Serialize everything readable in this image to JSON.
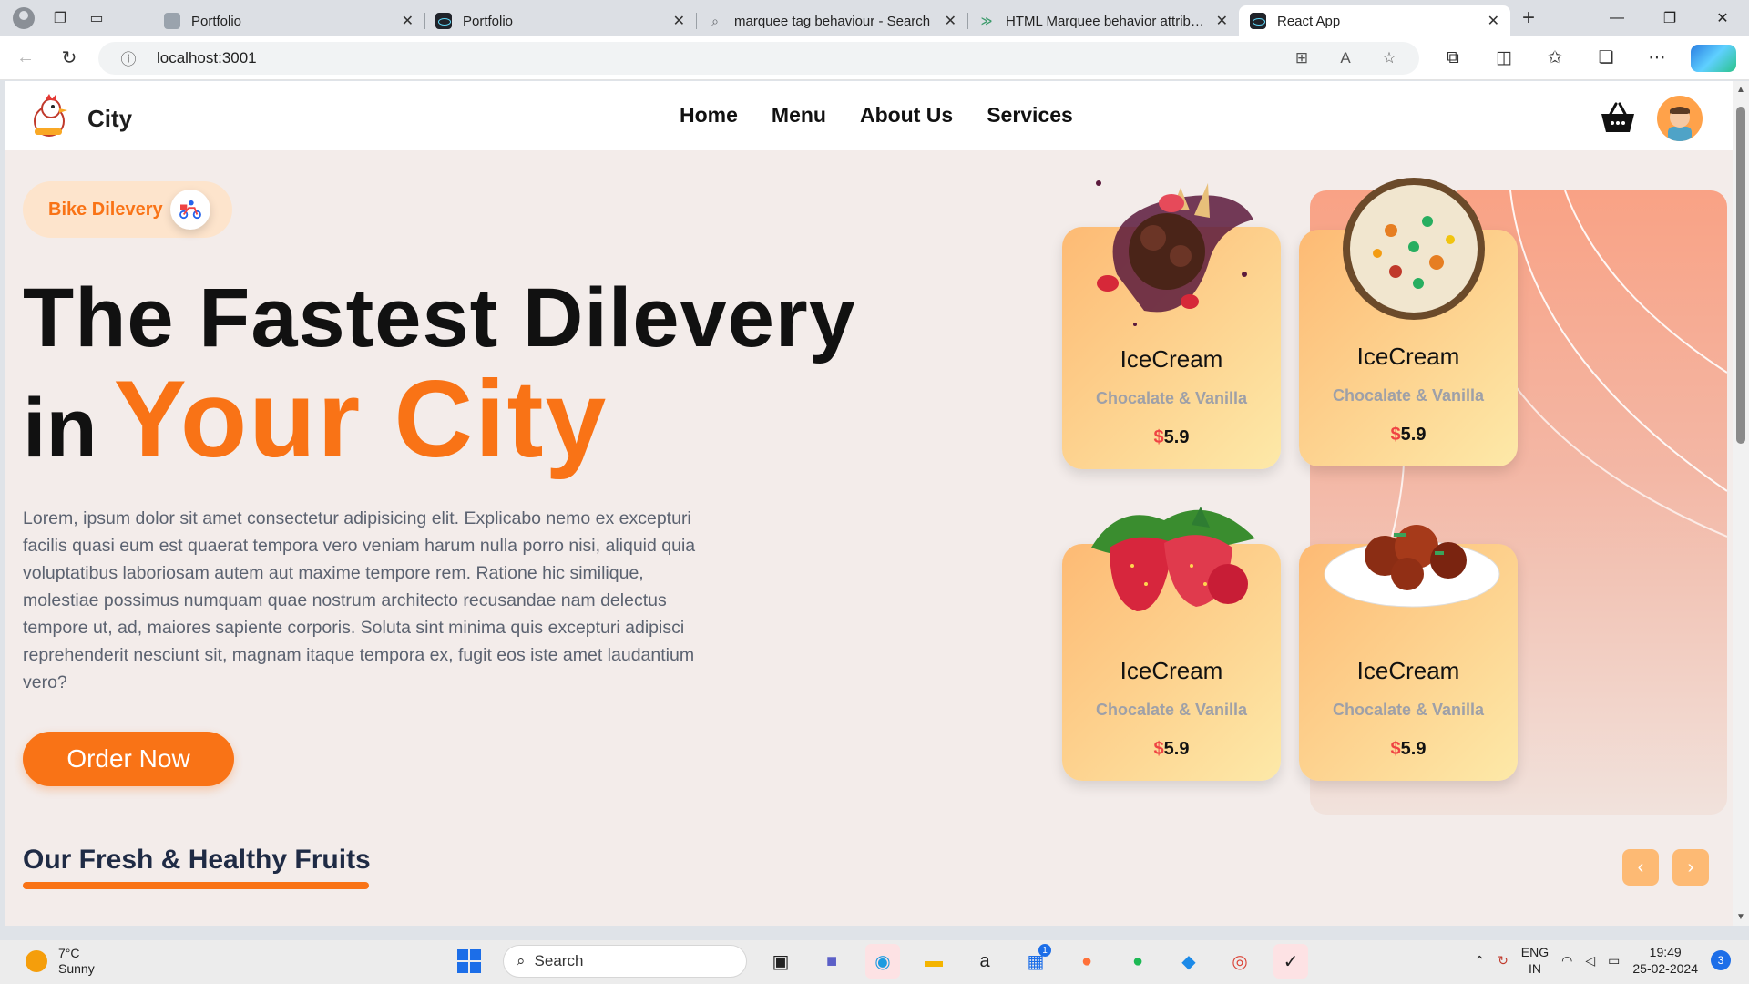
{
  "browser": {
    "tabs": [
      {
        "title": "Portfolio",
        "favicon": "generic-favicon"
      },
      {
        "title": "Portfolio",
        "favicon": "react-favicon"
      },
      {
        "title": "marquee tag behaviour - Search",
        "favicon": "search-favicon"
      },
      {
        "title": "HTML Marquee behavior attribute",
        "favicon": "code-favicon"
      },
      {
        "title": "React App",
        "favicon": "react-favicon",
        "active": true
      }
    ],
    "url": "localhost:3001"
  },
  "header": {
    "brand": "City",
    "menu": [
      "Home",
      "Menu",
      "About Us",
      "Services"
    ]
  },
  "hero": {
    "badge": "Bike Dilevery",
    "line1": "The Fastest Dilevery",
    "line2_prefix": "in",
    "line2_accent": "Your City",
    "description": "Lorem, ipsum dolor sit amet consectetur adipisicing elit. Explicabo nemo ex excepturi facilis quasi eum est quaerat tempora vero veniam harum nulla porro nisi, aliquid quia voluptatibus laboriosam autem aut maxime tempore rem. Ratione hic similique, molestiae possimus numquam quae nostrum architecto recusandae nam delectus tempore ut, ad, maiores sapiente corporis. Soluta sint minima quis excepturi adipisci reprehenderit nesciunt sit, magnam itaque tempora ex, fugit eos iste amet laudantium vero?",
    "order_button": "Order Now"
  },
  "cards": [
    {
      "title": "IceCream",
      "subtitle": "Chocalate & Vanilla",
      "currency": "$",
      "price": "5.9",
      "image": "icecream-image"
    },
    {
      "title": "IceCream",
      "subtitle": "Chocalate & Vanilla",
      "currency": "$",
      "price": "5.9",
      "image": "biryani-image"
    },
    {
      "title": "IceCream",
      "subtitle": "Chocalate & Vanilla",
      "currency": "$",
      "price": "5.9",
      "image": "strawberries-image"
    },
    {
      "title": "IceCream",
      "subtitle": "Chocalate & Vanilla",
      "currency": "$",
      "price": "5.9",
      "image": "chicken-image"
    }
  ],
  "section": {
    "title": "Our Fresh & Healthy Fruits"
  },
  "slider": {
    "prev": "‹",
    "next": "›"
  },
  "taskbar": {
    "weather_temp": "7°C",
    "weather_desc": "Sunny",
    "search_placeholder": "Search",
    "store_badge": "1",
    "lang_line1": "ENG",
    "lang_line2": "IN",
    "time": "19:49",
    "date": "25-02-2024",
    "notifications": "3"
  },
  "colors": {
    "accent": "#f97316",
    "page_bg": "#f3ecea",
    "card_from": "#fdba74",
    "card_to": "#fde9a8"
  }
}
